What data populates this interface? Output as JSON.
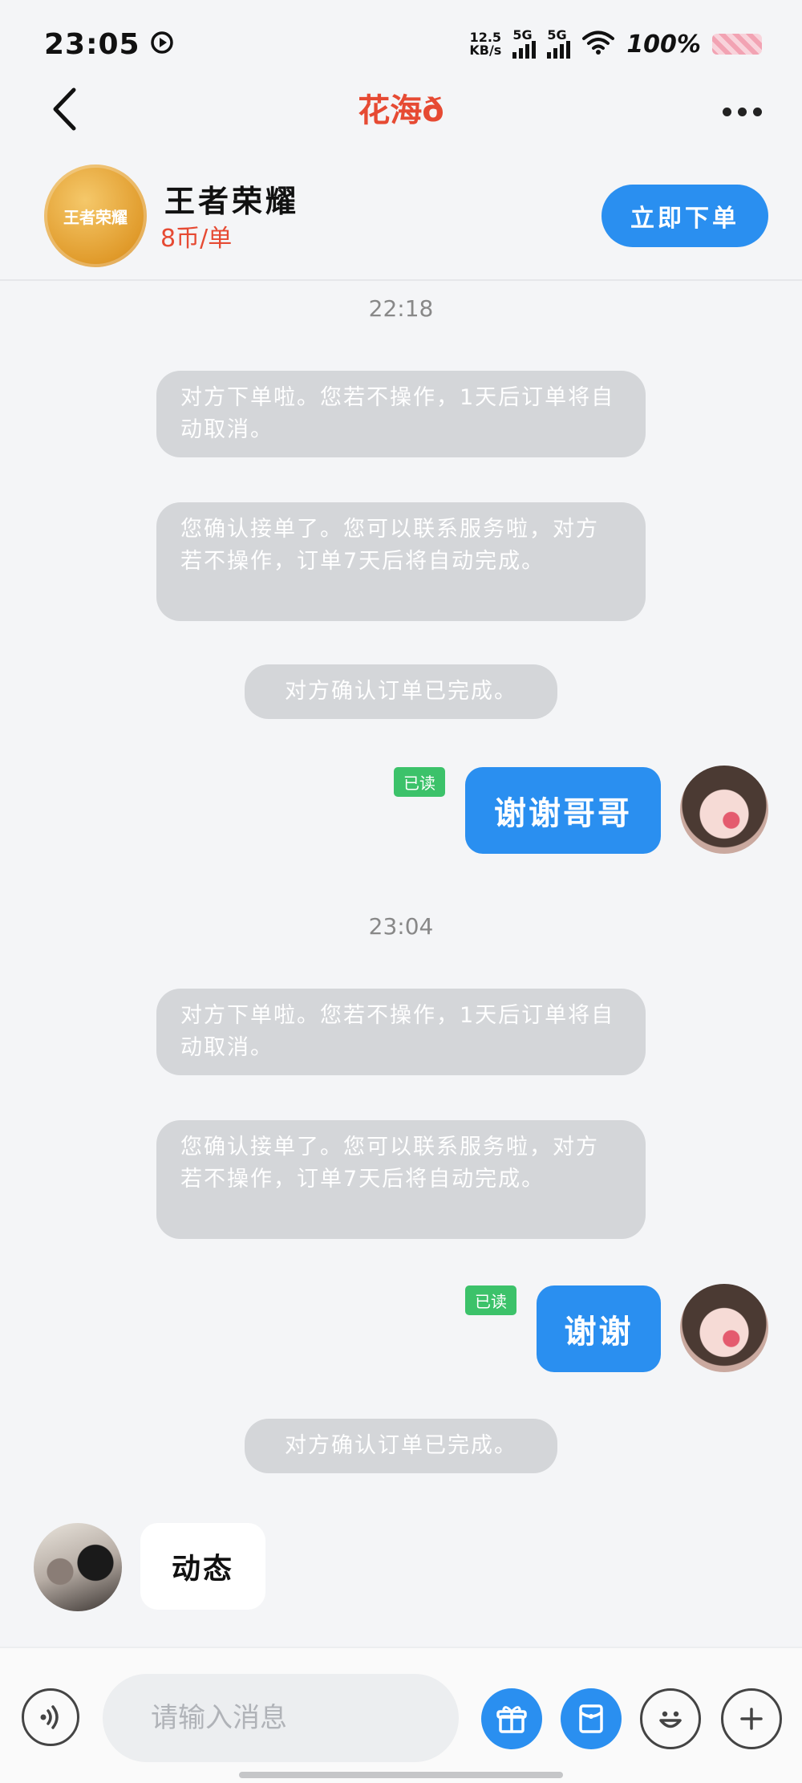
{
  "status_bar": {
    "time": "23:05",
    "net_speed_value": "12.5",
    "net_speed_unit": "KB/s",
    "signal1_label": "5G",
    "signal2_label": "5G",
    "battery_percent": "100%"
  },
  "header": {
    "title": "花海ð"
  },
  "game_card": {
    "logo_text": "王者荣耀",
    "name": "王者荣耀",
    "price": "8币/单",
    "order_button": "立即下单"
  },
  "chat": {
    "time_1": "22:18",
    "sys_1": "对方下单啦。您若不操作，1天后订单将自动取消。",
    "sys_2": "您确认接单了。您可以联系服务啦，对方若不操作，订单7天后将自动完成。",
    "sys_3": "对方确认订单已完成。",
    "read_1": "已读",
    "msg_1": "谢谢哥哥",
    "time_2": "23:04",
    "sys_4": "对方下单啦。您若不操作，1天后订单将自动取消。",
    "sys_5": "您确认接单了。您可以联系服务啦，对方若不操作，订单7天后将自动完成。",
    "read_2": "已读",
    "msg_2": "谢谢",
    "sys_6": "对方确认订单已完成。",
    "incoming_msg": "动态"
  },
  "input_bar": {
    "placeholder": "请输入消息",
    "icons": [
      "voice-icon",
      "gift-icon",
      "red-packet-icon",
      "emoji-icon",
      "plus-icon"
    ]
  },
  "colors": {
    "accent": "#2a8ff0",
    "title_red": "#e64a33",
    "system_bubble": "#d4d6d9",
    "read_badge": "#3cc26a"
  }
}
